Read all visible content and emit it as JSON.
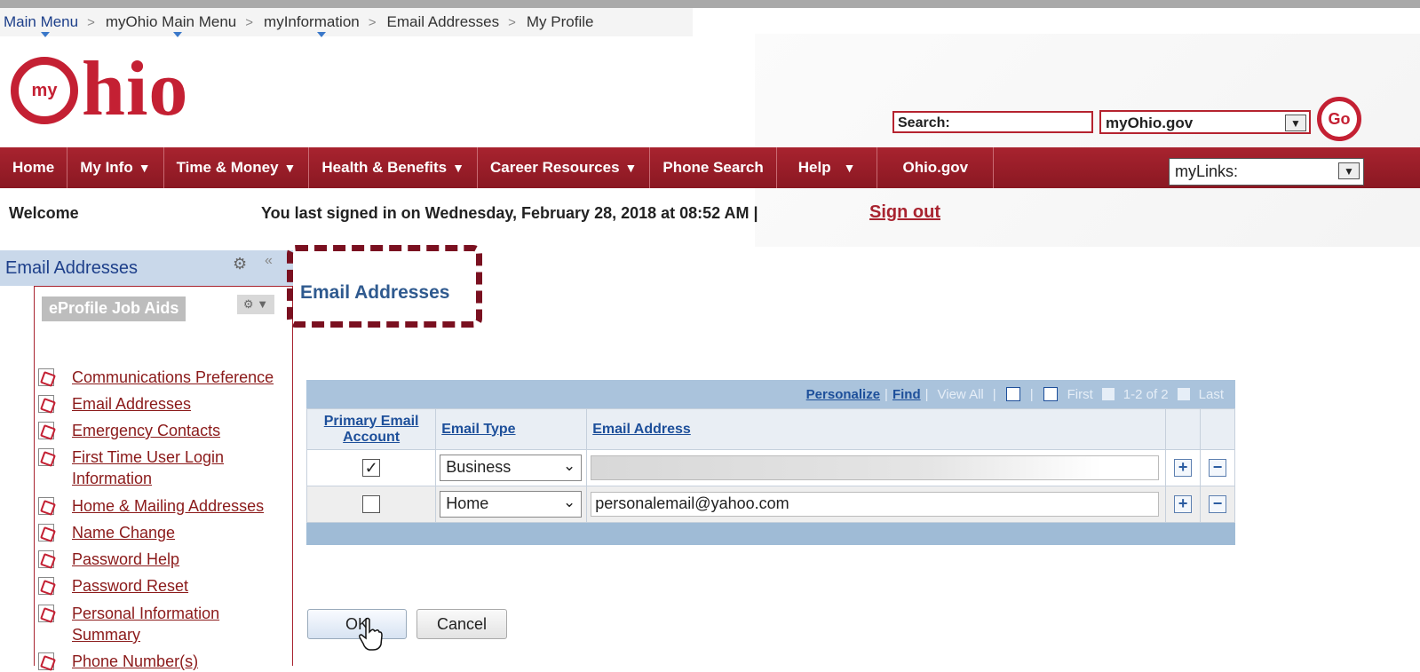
{
  "breadcrumb": [
    "Main Menu",
    "myOhio Main Menu",
    "myInformation",
    "Email Addresses",
    "My Profile"
  ],
  "logo": {
    "my": "my",
    "hio": "hio"
  },
  "search": {
    "label": "Search:",
    "scope": "myOhio.gov",
    "go": "Go"
  },
  "nav": {
    "items": [
      {
        "label": "Home",
        "dropdown": false
      },
      {
        "label": "My Info",
        "dropdown": true
      },
      {
        "label": "Time & Money",
        "dropdown": true
      },
      {
        "label": "Health & Benefits",
        "dropdown": true
      },
      {
        "label": "Career Resources",
        "dropdown": true
      },
      {
        "label": "Phone Search",
        "dropdown": false
      },
      {
        "label": "Help",
        "dropdown": true
      },
      {
        "label": "Ohio.gov",
        "dropdown": false
      }
    ],
    "mylinks": "myLinks:"
  },
  "welcome": {
    "label": "Welcome",
    "last_signed": "You last signed in on Wednesday, February 28, 2018 at 08:52 AM  |",
    "sign_out": "Sign out"
  },
  "left_panel": {
    "title": "Email Addresses",
    "job_aids_title": "eProfile Job Aids",
    "items": [
      "Communications Preference",
      "Email Addresses",
      "Emergency Contacts",
      "First Time User Login Information",
      "Home & Mailing Addresses",
      "Name Change",
      "Password Help",
      "Password Reset",
      "Personal Information Summary",
      "Phone Number(s)"
    ]
  },
  "main": {
    "title": "Email Addresses",
    "grid": {
      "toolbar": {
        "personalize": "Personalize",
        "find": "Find",
        "view_all": "View All",
        "first": "First",
        "range": "1-2 of 2",
        "last": "Last"
      },
      "headers": {
        "primary": "Primary Email Account",
        "type": "Email Type",
        "address": "Email Address"
      },
      "rows": [
        {
          "primary": true,
          "type": "Business",
          "address": ""
        },
        {
          "primary": false,
          "type": "Home",
          "address": "personalemail@yahoo.com"
        }
      ]
    },
    "ok": "OK",
    "cancel": "Cancel"
  }
}
